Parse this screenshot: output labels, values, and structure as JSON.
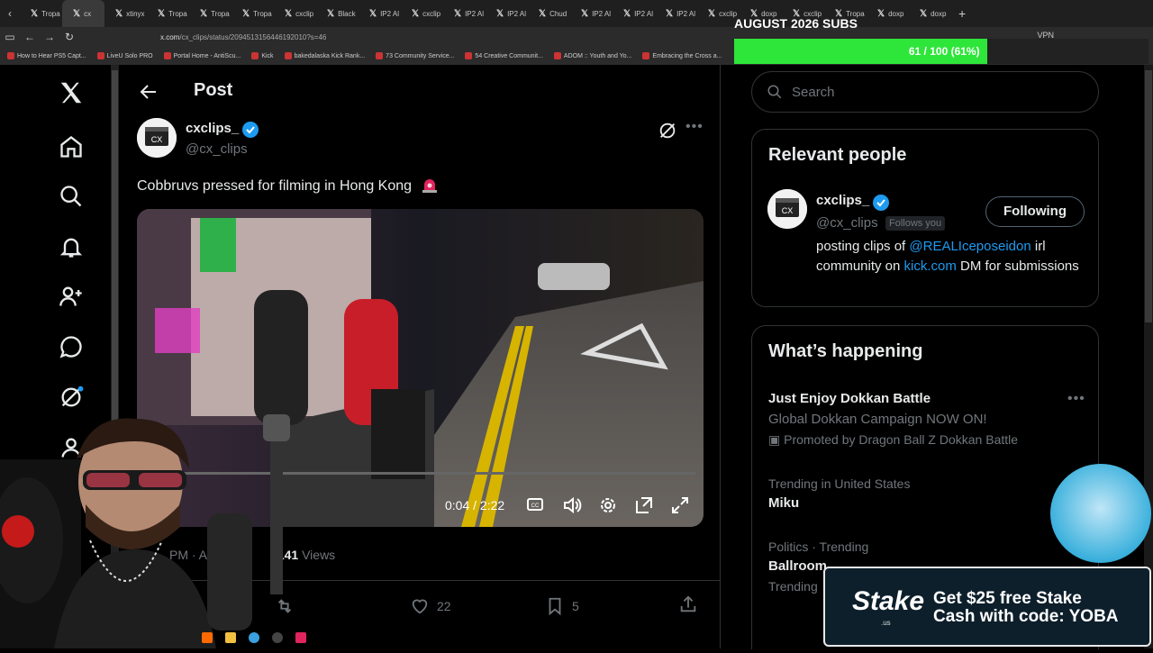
{
  "browser": {
    "tabs": [
      {
        "label": "Tropa"
      },
      {
        "label": "cx",
        "active": true
      },
      {
        "label": "xtinyx"
      },
      {
        "label": "Tropa"
      },
      {
        "label": "Tropa"
      },
      {
        "label": "Tropa"
      },
      {
        "label": "cxclip"
      },
      {
        "label": "Black"
      },
      {
        "label": "IP2 Al"
      },
      {
        "label": "cxclip"
      },
      {
        "label": "IP2 Al"
      },
      {
        "label": "IP2 Al"
      },
      {
        "label": "Chud"
      },
      {
        "label": "IP2 Al"
      },
      {
        "label": "IP2 Al"
      },
      {
        "label": "IP2 Al"
      },
      {
        "label": "cxclip"
      },
      {
        "label": "doxp"
      },
      {
        "label": "cxclip"
      },
      {
        "label": "Tropa"
      },
      {
        "label": "doxp"
      },
      {
        "label": "doxp"
      }
    ],
    "new_tab": "+",
    "url_host": "x.com",
    "url_path": "/cx_clips/status/2094513156446192010?s=46",
    "vpn_label": "VPN",
    "bookmarks": [
      "How to Hear PS5 Capt...",
      "LiveU Solo PRO",
      "Portal Home - AntiScu...",
      "Kick",
      "bakedalaska Kick Rank...",
      "73 Community Service...",
      "54 Creative Communit...",
      "ADOM :: Youth and Yo...",
      "Embracing the Cross a..."
    ]
  },
  "subgoal": {
    "title": "AUGUST 2026 SUBS",
    "progress_text": "61 / 100 (61%)",
    "progress": 0.61,
    "fill_color": "#2ee63a"
  },
  "post": {
    "header_title": "Post",
    "author_name": "cxclips_",
    "author_handle": "@cx_clips",
    "text": "Cobbruvs pressed for filming in Hong Kong",
    "video": {
      "time": "0:04 / 2:22",
      "progress": 0.03
    },
    "stats_prefix": "PM · Aug",
    "views_count": ",141",
    "views_label": "Views",
    "likes": "22",
    "bookmarks": "5"
  },
  "right": {
    "search_placeholder": "Search",
    "relevant_title": "Relevant people",
    "person": {
      "name": "cxclips_",
      "handle": "@cx_clips",
      "follows_you": "Follows you",
      "follow_button": "Following",
      "bio_1": "posting clips of ",
      "bio_link_1": "@REALIceposeidon",
      "bio_2": " irl community on ",
      "bio_link_2": "kick.com",
      "bio_3": " DM for submissions"
    },
    "happening_title": "What’s happening",
    "trends": [
      {
        "title": "Just Enjoy Dokkan Battle",
        "sub": "Global Dokkan Campaign NOW ON!",
        "promo": "Promoted by Dragon Ball Z Dokkan Battle"
      },
      {
        "meta": "Trending in United States",
        "title": "Miku"
      },
      {
        "meta": "Politics · Trending",
        "title": "Ballroom",
        "meta2": "Trending"
      }
    ]
  },
  "stake_ad": {
    "logo": "Stake",
    "logo_sub": ".us",
    "line1": "Get $25 free Stake",
    "line2": "Cash with code: YOBA"
  },
  "colors": {
    "accent": "#1d9bf0",
    "verified": "#1d9bf0",
    "bg": "#000000"
  }
}
